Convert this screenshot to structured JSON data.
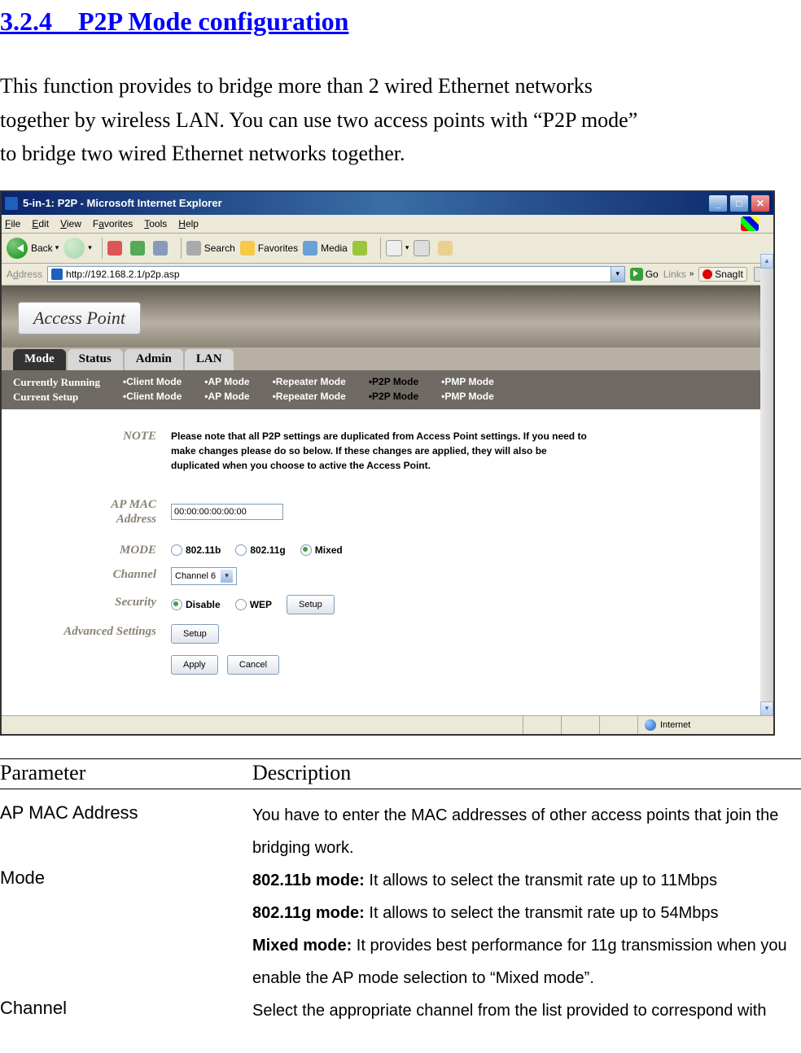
{
  "page": {
    "section_number": "3.2.4",
    "section_title": "P2P Mode configuration",
    "intro_l1": "This function provides to bridge more than 2 wired Ethernet networks",
    "intro_l2": "together by wireless LAN. You can use two access points with “P2P mode”",
    "intro_l3": "to bridge two wired Ethernet networks together."
  },
  "ie": {
    "title": "5-in-1: P2P - Microsoft Internet Explorer",
    "menu": [
      "File",
      "Edit",
      "View",
      "Favorites",
      "Tools",
      "Help"
    ],
    "toolbar": {
      "back": "Back",
      "search": "Search",
      "favorites": "Favorites",
      "media": "Media"
    },
    "address_label": "Address",
    "url": "http://192.168.2.1/p2p.asp",
    "go": "Go",
    "links": "Links",
    "snagit": "SnagIt",
    "status": "Internet"
  },
  "ap": {
    "banner": "Access Point",
    "tabs": [
      "Mode",
      "Status",
      "Admin",
      "LAN"
    ],
    "rows": {
      "running_label": "Currently Running",
      "setup_label": "Current Setup",
      "col1": [
        "•Client Mode",
        "•Client Mode"
      ],
      "col2": [
        "•AP Mode",
        "•AP Mode"
      ],
      "col3": [
        "•Repeater Mode",
        "•Repeater Mode"
      ],
      "col4": [
        "•P2P Mode",
        "•P2P Mode"
      ],
      "col5": [
        "•PMP Mode",
        "•PMP Mode"
      ]
    },
    "form": {
      "note_label": "NOTE",
      "note_text": "Please note that all P2P settings are duplicated from Access Point settings. If you need to make changes please do so below. If these changes are applied, they will also be duplicated when you choose to active the Access Point.",
      "mac_label": "AP MAC Address",
      "mac_value": "00:00:00:00:00:00",
      "mode_label": "MODE",
      "mode_opts": [
        "802.11b",
        "802.11g",
        "Mixed"
      ],
      "channel_label": "Channel",
      "channel_value": "Channel 6",
      "security_label": "Security",
      "security_opts": [
        "Disable",
        "WEP"
      ],
      "setup_btn": "Setup",
      "adv_label": "Advanced Settings",
      "apply": "Apply",
      "cancel": "Cancel"
    }
  },
  "table": {
    "h1": "Parameter",
    "h2": "Description",
    "r1p": "AP MAC Address",
    "r1d": "You have to enter the MAC addresses of other access points that join the bridging work.",
    "r2p": "Mode",
    "r2d1b": "802.11b mode:",
    "r2d1": " It allows to select the transmit rate up to 11Mbps",
    "r2d2b": "802.11g mode:",
    "r2d2": " It allows to select the transmit rate up to 54Mbps",
    "r2d3b": "Mixed mode:",
    "r2d3": " It provides best performance for 11g transmission when you enable the AP mode selection to “Mixed mode”.",
    "r3p": "Channel",
    "r3d": "Select the appropriate channel from the list provided to correspond with"
  }
}
